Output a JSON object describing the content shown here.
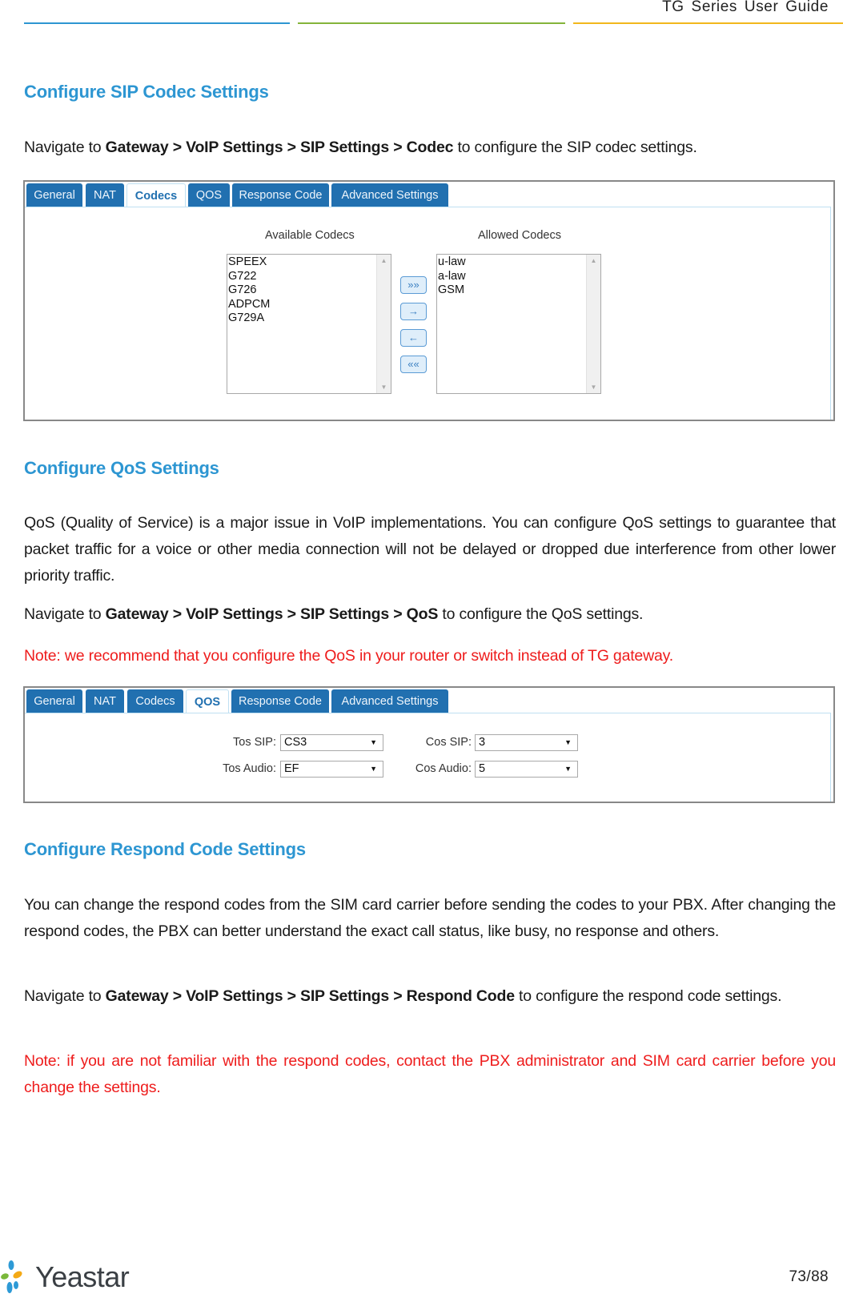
{
  "header": {
    "title": "TG  Series  User  Guide"
  },
  "sections": {
    "codec": {
      "title": "Configure SIP Codec Settings",
      "nav_prefix": "Navigate  to ",
      "nav_path": "Gateway > VoIP Settings > SIP Settings > Codec",
      "nav_suffix": " to configure the SIP codec settings."
    },
    "qos": {
      "title": "Configure QoS Settings",
      "description": "QoS (Quality of Service) is a major issue in VoIP implementations. You can configure QoS settings to guarantee that packet traffic for a voice or other media connection will not be delayed or dropped due interference from other lower priority traffic.",
      "nav_prefix": "Navigate  to ",
      "nav_path": "Gateway > VoIP Settings > SIP Settings > QoS",
      "nav_suffix": " to configure the QoS settings.",
      "note": "Note: we recommend that you configure the QoS in your router or switch instead of TG gateway."
    },
    "respond": {
      "title": "Configure Respond Code Settings",
      "description": "You can change the respond codes from the SIM card carrier before sending the codes to your PBX. After changing the respond codes, the PBX can better understand the exact call status, like busy, no response and others.",
      "nav_prefix": "Navigate to ",
      "nav_path": "Gateway >  VoIP Settings > SIP Settings > Respond Code",
      "nav_suffix": " to configure the respond code settings.",
      "note": "Note: if you are not familiar with the respond codes, contact the PBX administrator and SIM card carrier before you change the settings."
    }
  },
  "tabs": [
    "General",
    "NAT",
    "Codecs",
    "QOS",
    "Response Code",
    "Advanced Settings"
  ],
  "codec_panel": {
    "active_tab": "Codecs",
    "available_label": "Available Codecs",
    "allowed_label": "Allowed Codecs",
    "available": [
      "SPEEX",
      "G722",
      "G726",
      "ADPCM",
      "G729A"
    ],
    "allowed": [
      "u-law",
      "a-law",
      "GSM"
    ],
    "buttons": {
      "add_all": "»»",
      "add": "→",
      "remove": "←",
      "remove_all": "««"
    }
  },
  "qos_panel": {
    "active_tab": "QOS",
    "tos_sip_label": "Tos SIP:",
    "tos_sip_value": "CS3",
    "tos_audio_label": "Tos Audio:",
    "tos_audio_value": "EF",
    "cos_sip_label": "Cos SIP:",
    "cos_sip_value": "3",
    "cos_audio_label": "Cos Audio:",
    "cos_audio_value": "5",
    "caret": "▼"
  },
  "footer": {
    "brand": "Yeastar",
    "page": "73/88"
  },
  "colors": {
    "heading": "#2d96d2",
    "note": "#ee1c1c",
    "tab": "#2170b0",
    "rule_blue": "#2d96d2",
    "rule_green": "#84b43a",
    "rule_orange": "#f1b71c"
  }
}
